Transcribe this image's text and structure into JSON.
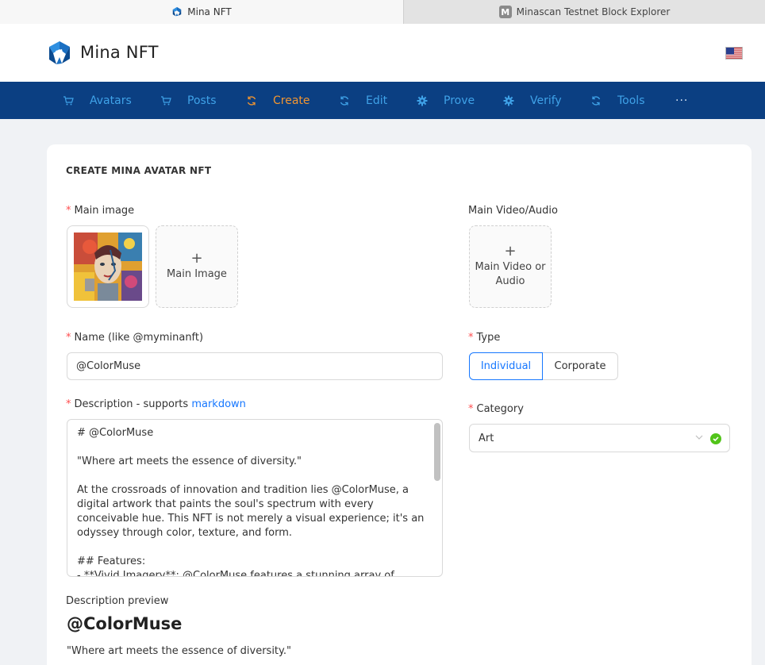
{
  "browser": {
    "tabs": [
      {
        "label": "Mina NFT",
        "icon": "mina-logo-icon",
        "active": true
      },
      {
        "label": "Minascan Testnet Block Explorer",
        "icon": "minascan-m-icon",
        "active": false
      }
    ]
  },
  "header": {
    "brand": "Mina NFT",
    "logo_icon": "mina-logo-icon",
    "language_icon": "us-flag-icon"
  },
  "nav": {
    "items": [
      {
        "label": "Avatars",
        "icon": "cart-icon",
        "active": false
      },
      {
        "label": "Posts",
        "icon": "cart-icon",
        "active": false
      },
      {
        "label": "Create",
        "icon": "sync-icon",
        "active": true
      },
      {
        "label": "Edit",
        "icon": "sync-icon",
        "active": false
      },
      {
        "label": "Prove",
        "icon": "gear-icon",
        "active": false
      },
      {
        "label": "Verify",
        "icon": "gear-icon",
        "active": false
      },
      {
        "label": "Tools",
        "icon": "sync-icon",
        "active": false
      }
    ],
    "more": "···",
    "colors": {
      "bar": "#0b3f82",
      "item": "#3fa2e8",
      "active": "#f29530"
    }
  },
  "form": {
    "title": "CREATE MINA AVATAR NFT",
    "main_image": {
      "label": "Main image",
      "upload_label": "Main Image"
    },
    "main_video": {
      "label": "Main Video/Audio",
      "upload_label": "Main Video or Audio"
    },
    "name": {
      "label": "Name (like @myminanft)",
      "value": "@ColorMuse"
    },
    "type": {
      "label": "Type",
      "options": [
        "Individual",
        "Corporate"
      ],
      "selected": "Individual"
    },
    "description": {
      "label_prefix": "Description - supports ",
      "label_link": "markdown",
      "value": "# @ColorMuse\n\n\"Where art meets the essence of diversity.\"\n\nAt the crossroads of innovation and tradition lies @ColorMuse, a digital artwork that paints the soul's spectrum with every conceivable hue. This NFT is not merely a visual experience; it's an odyssey through color, texture, and form.\n\n## Features:\n- **Vivid Imagery**: @ColorMuse features a stunning array of"
    },
    "category": {
      "label": "Category",
      "value": "Art",
      "status": "valid"
    },
    "preview": {
      "label": "Description preview",
      "heading": "@ColorMuse",
      "quote": "\"Where art meets the essence of diversity.\""
    }
  }
}
